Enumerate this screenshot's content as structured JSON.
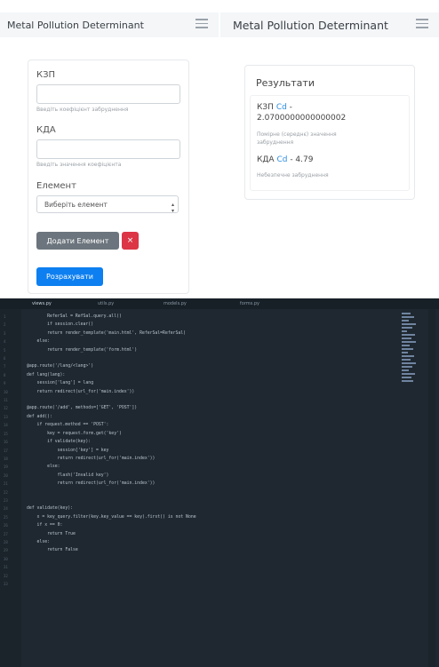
{
  "nav": {
    "brand_left": "Metal Pollution Determinant",
    "brand_right": "Metal Pollution Determinant"
  },
  "form": {
    "kzp_label": "КЗП",
    "kzp_hint": "Введіть коефіцієнт забруднення",
    "kda_label": "КДА",
    "kda_hint": "Введіть значення коефіцієнта",
    "element_label": "Елемент",
    "element_selected": "Виберіть елемент",
    "add_button": "Додати Елемент",
    "remove_button": "×",
    "calculate_button": "Розрахувати"
  },
  "results": {
    "title": "Результати",
    "kzp_label": "КЗП",
    "kzp_element": "Cd",
    "kzp_sep": " -",
    "kzp_value": "2.0700000000000002",
    "kzp_note_1": "Помірне (середнє) значення",
    "kzp_note_2": "забруднення",
    "kda_label": "КДА",
    "kda_element": "Cd",
    "kda_value": " - 4.79",
    "kda_note": "Небезпечне забруднення"
  },
  "colors": {
    "primary": "#0d7ff0",
    "secondary": "#6c757d",
    "danger": "#dc3545",
    "result_accent": "#2f8ee0",
    "editor_bg": "#1f2830"
  },
  "editor": {
    "tabs": [
      "views.py",
      "utils.py",
      "models.py",
      "forms.py"
    ],
    "line_numbers": "1\n2\n3\n4\n5\n6\n7\n8\n9\n10\n11\n12\n13\n14\n15\n16\n17\n18\n19\n20\n21\n22\n23\n24\n25\n26\n27\n28\n29\n30\n31\n32\n33",
    "code": "        ReferSal = RefSal.query.all()\n        if session.clear()\n        return render_template('main.html', ReferSal=ReferSal)\n    else:\n        return render_template('form.html')\n\n@app.route('/lang/<lang>')\ndef lang(lang):\n    session['lang'] = lang\n    return redirect(url_for('main.index'))\n\n@app.route('/add', methods=['GET', 'POST'])\ndef add():\n    if request.method == 'POST':\n        key = request.form.get('key')\n        if validate(key):\n            session['key'] = key\n            return redirect(url_for('main.index'))\n        else:\n            flash('Invalid key')\n            return redirect(url_for('main.index'))\n\n\ndef validate(key):\n    x = key_query.filter(key.key_value == key).first() is not None\n    if x == 0:\n        return True\n    else:\n        return False"
  }
}
